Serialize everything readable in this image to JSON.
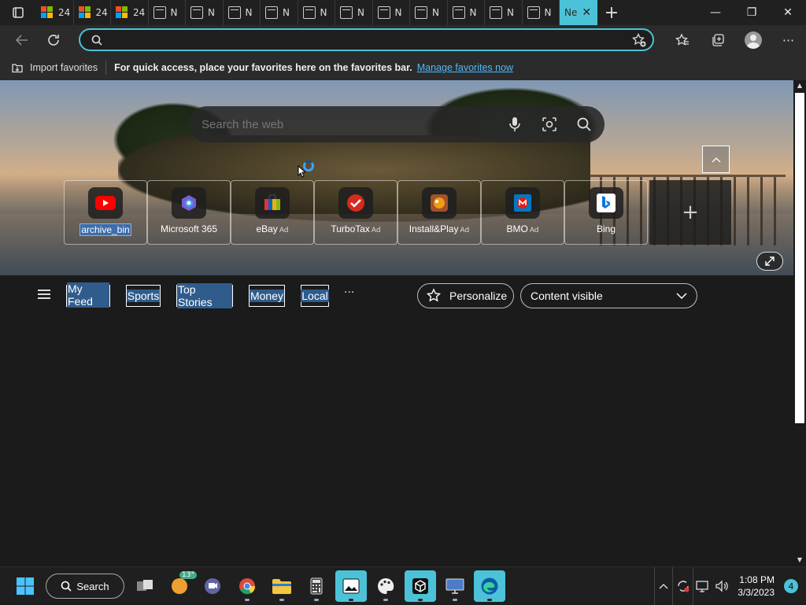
{
  "tabs": [
    {
      "label": "24",
      "icon": "microsoft-logo-icon"
    },
    {
      "label": "24",
      "icon": "microsoft-logo-icon"
    },
    {
      "label": "24",
      "icon": "microsoft-logo-icon"
    },
    {
      "label": "N",
      "icon": "page-icon"
    },
    {
      "label": "N",
      "icon": "page-icon"
    },
    {
      "label": "N",
      "icon": "page-icon"
    },
    {
      "label": "N",
      "icon": "page-icon"
    },
    {
      "label": "N",
      "icon": "page-icon"
    },
    {
      "label": "N",
      "icon": "page-icon"
    },
    {
      "label": "N",
      "icon": "page-icon"
    },
    {
      "label": "N",
      "icon": "page-icon"
    },
    {
      "label": "N",
      "icon": "page-icon"
    },
    {
      "label": "N",
      "icon": "page-icon"
    },
    {
      "label": "N",
      "icon": "page-icon"
    },
    {
      "label": "Ne",
      "icon": "none",
      "active": true
    }
  ],
  "address": {
    "placeholder": "",
    "value": ""
  },
  "favorites_bar": {
    "import_label": "Import favorites",
    "message": "For quick access, place your favorites here on the favorites bar.",
    "link": "Manage favorites now"
  },
  "hero_search": {
    "placeholder": "Search the web"
  },
  "tiles": [
    {
      "label": "archive_bin",
      "ad": "",
      "icon": "youtube-icon"
    },
    {
      "label": "Microsoft 365",
      "ad": "",
      "icon": "microsoft-365-icon"
    },
    {
      "label": "eBay",
      "ad": "Ad",
      "icon": "ebay-icon"
    },
    {
      "label": "TurboTax",
      "ad": "Ad",
      "icon": "turbotax-icon"
    },
    {
      "label": "Install&Play",
      "ad": "Ad",
      "icon": "game-icon"
    },
    {
      "label": "BMO",
      "ad": "Ad",
      "icon": "bmo-icon"
    },
    {
      "label": "Bing",
      "ad": "",
      "icon": "bing-icon"
    }
  ],
  "feed": {
    "tabs": [
      "My Feed",
      "Sports",
      "Top Stories",
      "Money",
      "Local"
    ],
    "more": "···",
    "personalize": "Personalize",
    "content_visible": "Content visible"
  },
  "taskbar": {
    "search_label": "Search",
    "weather_temp": "13°",
    "time": "1:08 PM",
    "date": "3/3/2023",
    "notifications": "4"
  },
  "colors": {
    "accent": "#4cc2d8",
    "link": "#4fb8ff",
    "page_bg": "#1b1b1b"
  }
}
